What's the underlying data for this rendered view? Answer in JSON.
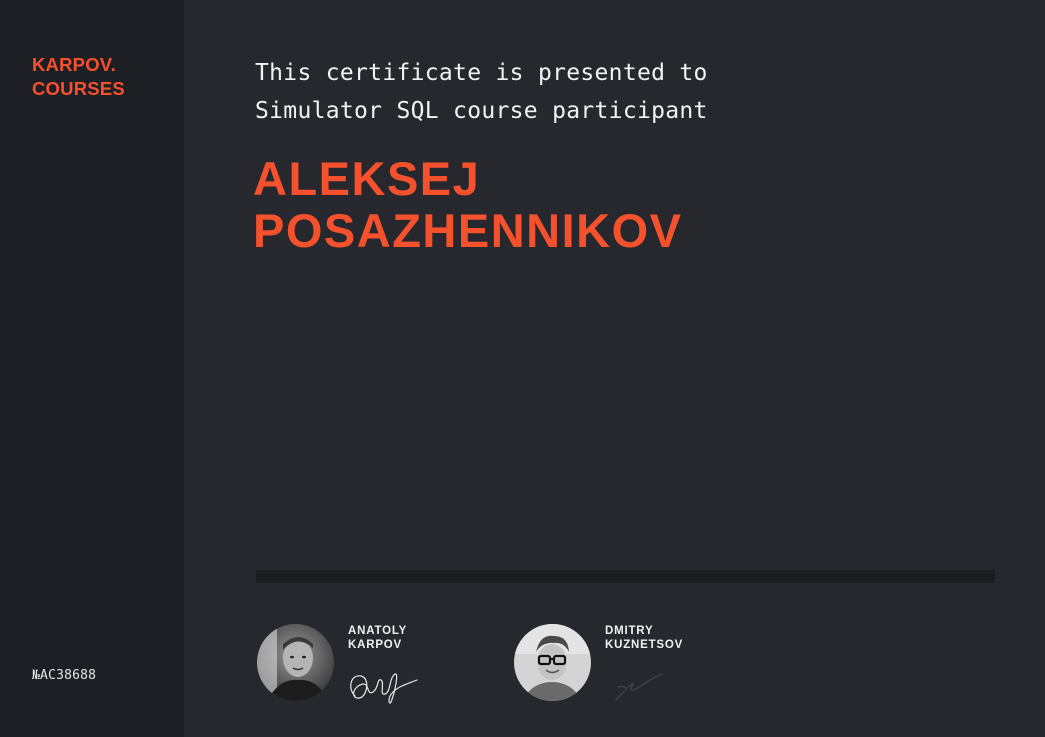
{
  "brand": {
    "logo_line1": "KARPOV.",
    "logo_line2": "COURSES",
    "accent_color": "#f4512c"
  },
  "certificate": {
    "intro_line1": "This certificate is presented to",
    "intro_line2": "Simulator SQL course participant",
    "recipient_line1": "ALEKSEJ",
    "recipient_line2": "POSAZHENNIKOV",
    "number": "№AC38688"
  },
  "signers": [
    {
      "name_line1": "ANATOLY",
      "name_line2": "KARPOV",
      "avatar_icon": "person-photo-icon",
      "signature_icon": "handwritten-signature-icon"
    },
    {
      "name_line1": "DMITRY",
      "name_line2": "KUZNETSOV",
      "avatar_icon": "person-photo-icon",
      "signature_icon": "handwritten-signature-icon"
    }
  ],
  "colors": {
    "background": "#26282e",
    "sidebar": "#1d1f24",
    "divider": "#1b1d21",
    "text": "#f2f2f2"
  }
}
